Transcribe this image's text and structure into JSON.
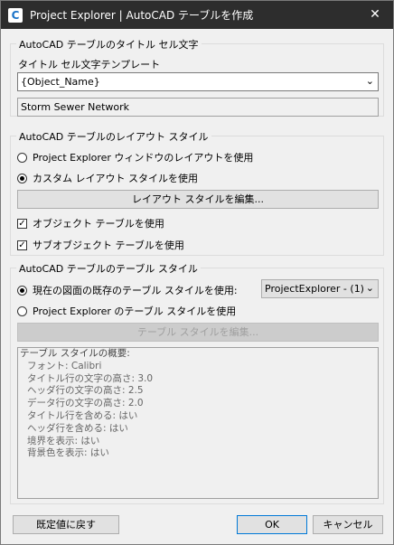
{
  "window": {
    "title": "Project Explorer | AutoCAD テーブルを作成",
    "icon_letter": "C",
    "close": "✕"
  },
  "title_group": {
    "legend": "AutoCAD テーブルのタイトル セル文字",
    "template_label": "タイトル セル文字テンプレート",
    "template_value": "{Object_Name}",
    "preview": "Storm Sewer Network"
  },
  "layout_group": {
    "legend": "AutoCAD テーブルのレイアウト スタイル",
    "radio_window_layout": "Project Explorer ウィンドウのレイアウトを使用",
    "radio_custom_layout": "カスタム レイアウト スタイルを使用",
    "edit_layout_button": "レイアウト スタイルを編集...",
    "check_object": "オブジェクト テーブルを使用",
    "check_subobject": "サブオブジェクト テーブルを使用",
    "check_mark": "✓"
  },
  "style_group": {
    "legend": "AutoCAD テーブルのテーブル スタイル",
    "radio_existing": "現在の図面の既存のテーブル スタイルを使用:",
    "style_select": "ProjectExplorer - (1)",
    "radio_project": "Project Explorer のテーブル スタイルを使用",
    "edit_style_button": "テーブル スタイルを編集..."
  },
  "summary": {
    "heading": "テーブル スタイルの概要:",
    "items": [
      "フォント: Calibri",
      "タイトル行の文字の高さ: 3.0",
      "ヘッダ行の文字の高さ: 2.5",
      "データ行の文字の高さ: 2.0",
      "タイトル行を含める: はい",
      "ヘッダ行を含める: はい",
      "境界を表示: はい",
      "背景色を表示: はい"
    ]
  },
  "footer": {
    "reset": "既定値に戻す",
    "ok": "OK",
    "cancel": "キャンセル"
  },
  "icons": {
    "dropdown": "chevron-down-icon"
  }
}
